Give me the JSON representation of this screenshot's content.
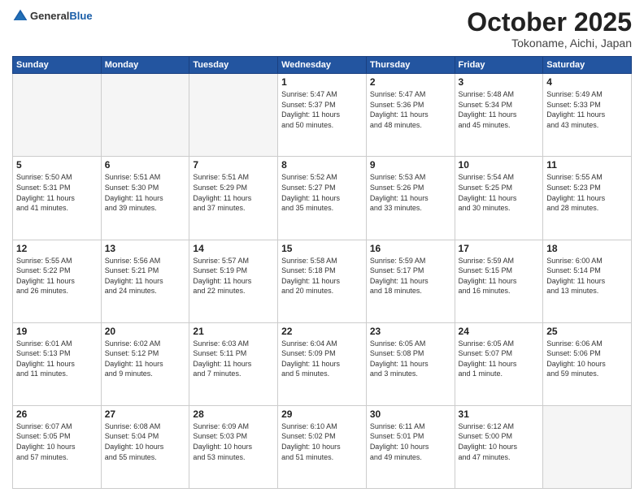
{
  "header": {
    "logo_general": "General",
    "logo_blue": "Blue",
    "month": "October 2025",
    "location": "Tokoname, Aichi, Japan"
  },
  "days_of_week": [
    "Sunday",
    "Monday",
    "Tuesday",
    "Wednesday",
    "Thursday",
    "Friday",
    "Saturday"
  ],
  "weeks": [
    [
      {
        "day": "",
        "info": ""
      },
      {
        "day": "",
        "info": ""
      },
      {
        "day": "",
        "info": ""
      },
      {
        "day": "1",
        "info": "Sunrise: 5:47 AM\nSunset: 5:37 PM\nDaylight: 11 hours\nand 50 minutes."
      },
      {
        "day": "2",
        "info": "Sunrise: 5:47 AM\nSunset: 5:36 PM\nDaylight: 11 hours\nand 48 minutes."
      },
      {
        "day": "3",
        "info": "Sunrise: 5:48 AM\nSunset: 5:34 PM\nDaylight: 11 hours\nand 45 minutes."
      },
      {
        "day": "4",
        "info": "Sunrise: 5:49 AM\nSunset: 5:33 PM\nDaylight: 11 hours\nand 43 minutes."
      }
    ],
    [
      {
        "day": "5",
        "info": "Sunrise: 5:50 AM\nSunset: 5:31 PM\nDaylight: 11 hours\nand 41 minutes."
      },
      {
        "day": "6",
        "info": "Sunrise: 5:51 AM\nSunset: 5:30 PM\nDaylight: 11 hours\nand 39 minutes."
      },
      {
        "day": "7",
        "info": "Sunrise: 5:51 AM\nSunset: 5:29 PM\nDaylight: 11 hours\nand 37 minutes."
      },
      {
        "day": "8",
        "info": "Sunrise: 5:52 AM\nSunset: 5:27 PM\nDaylight: 11 hours\nand 35 minutes."
      },
      {
        "day": "9",
        "info": "Sunrise: 5:53 AM\nSunset: 5:26 PM\nDaylight: 11 hours\nand 33 minutes."
      },
      {
        "day": "10",
        "info": "Sunrise: 5:54 AM\nSunset: 5:25 PM\nDaylight: 11 hours\nand 30 minutes."
      },
      {
        "day": "11",
        "info": "Sunrise: 5:55 AM\nSunset: 5:23 PM\nDaylight: 11 hours\nand 28 minutes."
      }
    ],
    [
      {
        "day": "12",
        "info": "Sunrise: 5:55 AM\nSunset: 5:22 PM\nDaylight: 11 hours\nand 26 minutes."
      },
      {
        "day": "13",
        "info": "Sunrise: 5:56 AM\nSunset: 5:21 PM\nDaylight: 11 hours\nand 24 minutes."
      },
      {
        "day": "14",
        "info": "Sunrise: 5:57 AM\nSunset: 5:19 PM\nDaylight: 11 hours\nand 22 minutes."
      },
      {
        "day": "15",
        "info": "Sunrise: 5:58 AM\nSunset: 5:18 PM\nDaylight: 11 hours\nand 20 minutes."
      },
      {
        "day": "16",
        "info": "Sunrise: 5:59 AM\nSunset: 5:17 PM\nDaylight: 11 hours\nand 18 minutes."
      },
      {
        "day": "17",
        "info": "Sunrise: 5:59 AM\nSunset: 5:15 PM\nDaylight: 11 hours\nand 16 minutes."
      },
      {
        "day": "18",
        "info": "Sunrise: 6:00 AM\nSunset: 5:14 PM\nDaylight: 11 hours\nand 13 minutes."
      }
    ],
    [
      {
        "day": "19",
        "info": "Sunrise: 6:01 AM\nSunset: 5:13 PM\nDaylight: 11 hours\nand 11 minutes."
      },
      {
        "day": "20",
        "info": "Sunrise: 6:02 AM\nSunset: 5:12 PM\nDaylight: 11 hours\nand 9 minutes."
      },
      {
        "day": "21",
        "info": "Sunrise: 6:03 AM\nSunset: 5:11 PM\nDaylight: 11 hours\nand 7 minutes."
      },
      {
        "day": "22",
        "info": "Sunrise: 6:04 AM\nSunset: 5:09 PM\nDaylight: 11 hours\nand 5 minutes."
      },
      {
        "day": "23",
        "info": "Sunrise: 6:05 AM\nSunset: 5:08 PM\nDaylight: 11 hours\nand 3 minutes."
      },
      {
        "day": "24",
        "info": "Sunrise: 6:05 AM\nSunset: 5:07 PM\nDaylight: 11 hours\nand 1 minute."
      },
      {
        "day": "25",
        "info": "Sunrise: 6:06 AM\nSunset: 5:06 PM\nDaylight: 10 hours\nand 59 minutes."
      }
    ],
    [
      {
        "day": "26",
        "info": "Sunrise: 6:07 AM\nSunset: 5:05 PM\nDaylight: 10 hours\nand 57 minutes."
      },
      {
        "day": "27",
        "info": "Sunrise: 6:08 AM\nSunset: 5:04 PM\nDaylight: 10 hours\nand 55 minutes."
      },
      {
        "day": "28",
        "info": "Sunrise: 6:09 AM\nSunset: 5:03 PM\nDaylight: 10 hours\nand 53 minutes."
      },
      {
        "day": "29",
        "info": "Sunrise: 6:10 AM\nSunset: 5:02 PM\nDaylight: 10 hours\nand 51 minutes."
      },
      {
        "day": "30",
        "info": "Sunrise: 6:11 AM\nSunset: 5:01 PM\nDaylight: 10 hours\nand 49 minutes."
      },
      {
        "day": "31",
        "info": "Sunrise: 6:12 AM\nSunset: 5:00 PM\nDaylight: 10 hours\nand 47 minutes."
      },
      {
        "day": "",
        "info": ""
      }
    ]
  ]
}
